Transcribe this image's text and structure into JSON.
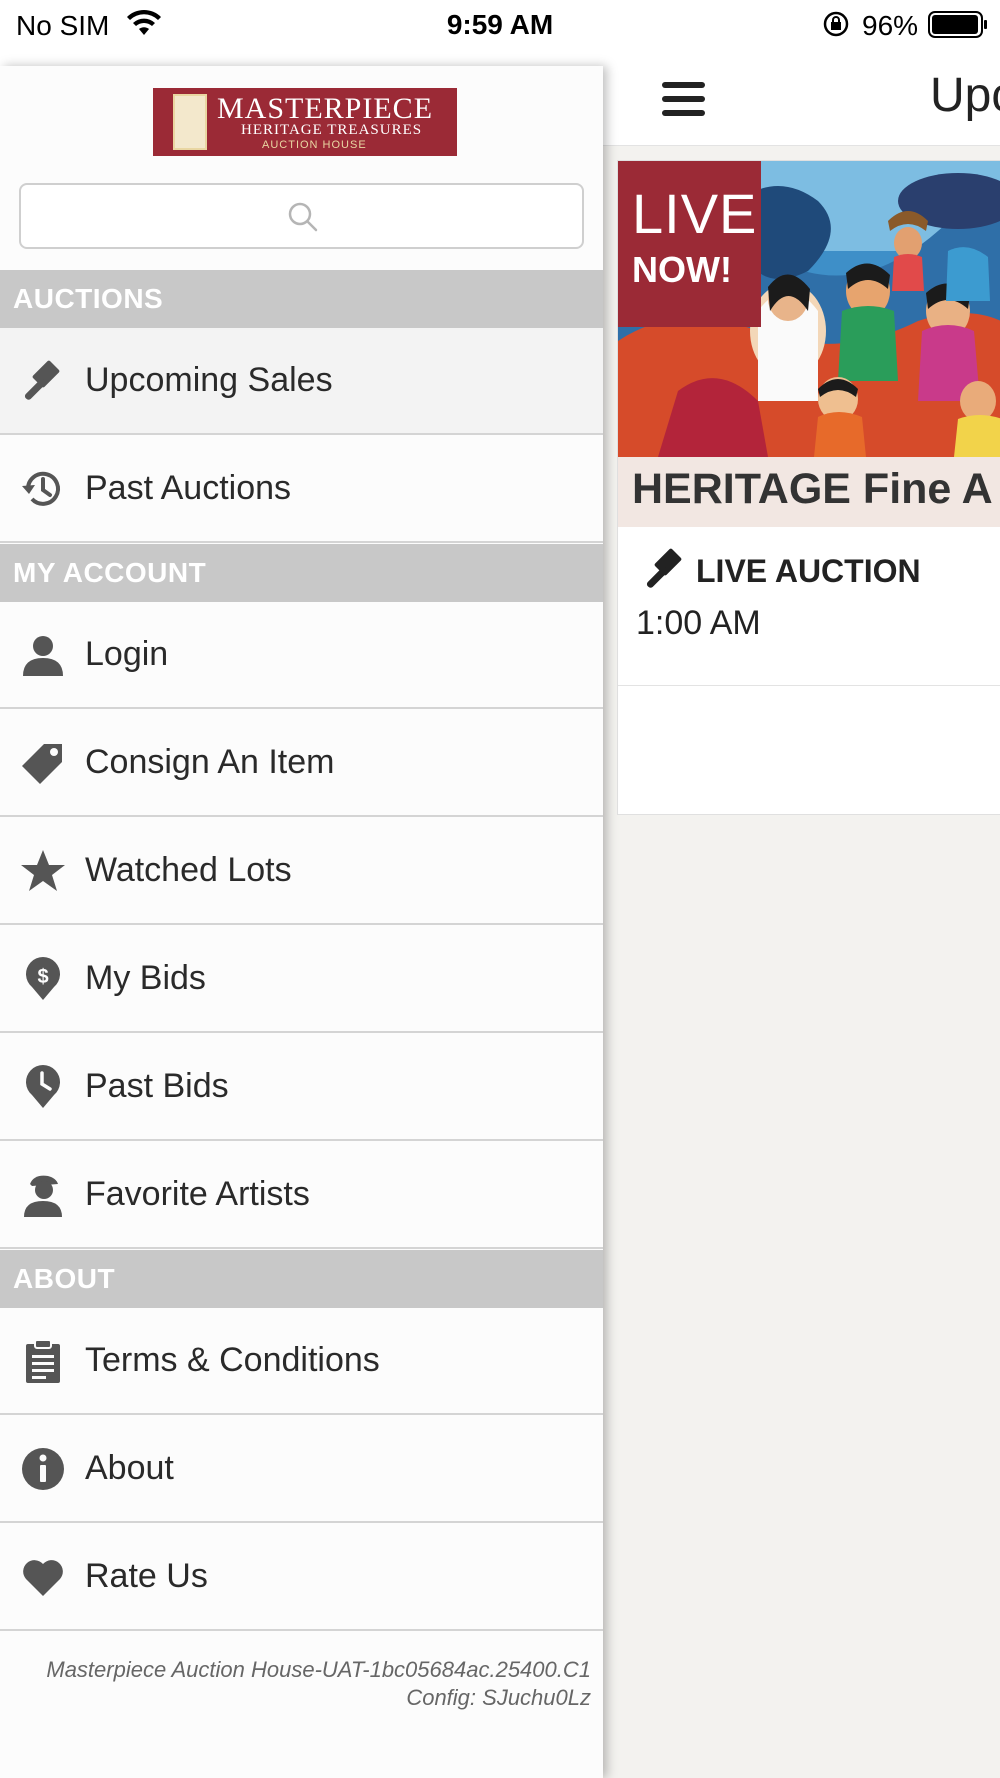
{
  "status_bar": {
    "carrier": "No SIM",
    "time": "9:59 AM",
    "battery": "96%"
  },
  "drawer": {
    "logo": {
      "line1": "MASTERPIECE",
      "line2": "HERITAGE TREASURES",
      "line3": "AUCTION HOUSE"
    },
    "search": {
      "placeholder": ""
    },
    "sections": {
      "auctions": "AUCTIONS",
      "my_account": "MY ACCOUNT",
      "about": "ABOUT"
    },
    "items": {
      "upcoming_sales": "Upcoming Sales",
      "past_auctions": "Past Auctions",
      "login": "Login",
      "consign": "Consign An Item",
      "watched_lots": "Watched Lots",
      "my_bids": "My Bids",
      "past_bids": "Past Bids",
      "favorite_artists": "Favorite Artists",
      "terms": "Terms & Conditions",
      "about": "About",
      "rate_us": "Rate Us"
    },
    "footer": {
      "line1": "Masterpiece Auction House-UAT-1bc05684ac.25400.C1",
      "line2": "Config: SJuchu0Lz"
    }
  },
  "main": {
    "title": "Upc",
    "card": {
      "badge_line1": "LIVE",
      "badge_line2": "NOW!",
      "title": "HERITAGE Fine A",
      "type": "LIVE AUCTION",
      "time": "1:00 AM"
    }
  },
  "colors": {
    "brand": "#9b2a36",
    "section_header": "#c8c8c8",
    "icon": "#555555"
  }
}
